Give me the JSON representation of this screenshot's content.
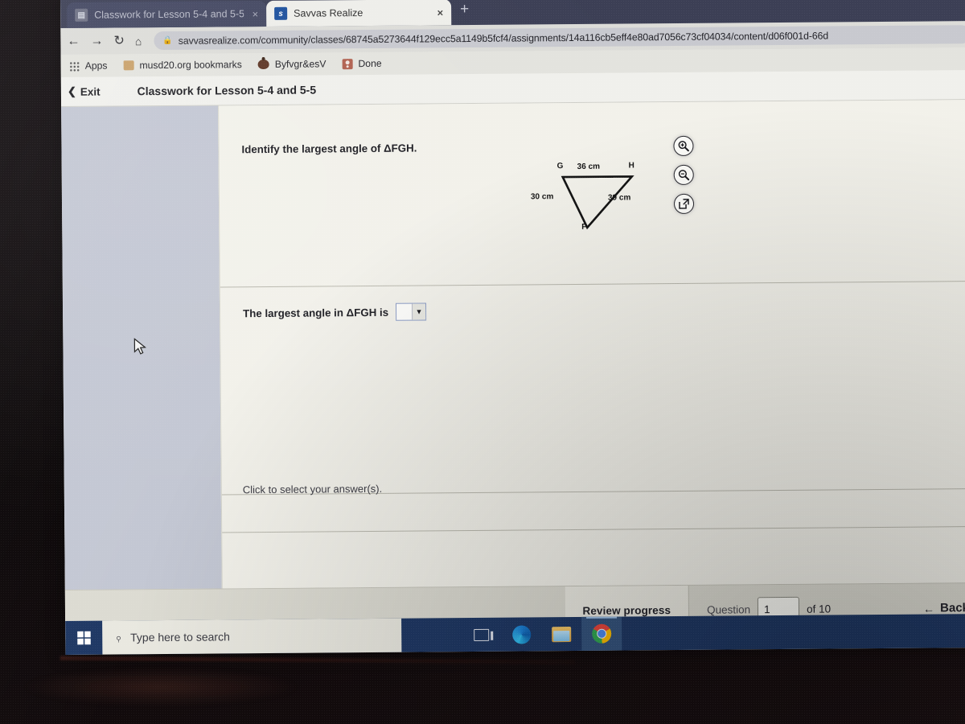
{
  "browser": {
    "tabs": [
      {
        "title": "Classwork for Lesson 5-4 and 5-5",
        "favicon": "page-icon",
        "close": "×",
        "active": false
      },
      {
        "title": "Savvas Realize",
        "favicon": "savvas-favicon",
        "close": "×",
        "active": true
      }
    ],
    "new_tab_label": "+",
    "nav": {
      "back": "←",
      "forward": "→",
      "reload": "↻",
      "home": "⌂",
      "lock_icon": "lock-icon",
      "url": "savvasrealize.com/community/classes/68745a5273644f129ecc5a1149b5fcf4/assignments/14a116cb5eff4e80ad7056c73cf04034/content/d06f001d-66d"
    },
    "bookmarks": [
      {
        "label": "Apps",
        "icon": "apps-grid-icon"
      },
      {
        "label": "musd20.org bookmarks",
        "icon": "folder-icon"
      },
      {
        "label": "Byfvgr&esV",
        "icon": "pumpkin-icon"
      },
      {
        "label": "Done",
        "icon": "contact-icon"
      }
    ]
  },
  "app": {
    "exit_label": "Exit",
    "lesson_title": "Classwork for Lesson 5-4 and 5-5"
  },
  "question": {
    "stem": "Identify the largest angle of ΔFGH.",
    "answer_prompt": "The largest angle in ΔFGH is",
    "dropdown_value": "",
    "dropdown_arrow": "▼",
    "hint": "Click to select your answer(s).",
    "figure_tools": [
      {
        "name": "zoom-in-icon",
        "label": "zoom in"
      },
      {
        "name": "zoom-out-icon",
        "label": "zoom out"
      },
      {
        "name": "open-external-icon",
        "label": "open in new window"
      }
    ]
  },
  "figure": {
    "type": "triangle-diagram",
    "vertices": [
      {
        "label": "G",
        "position": "top-left"
      },
      {
        "label": "H",
        "position": "top-right"
      },
      {
        "label": "F",
        "position": "bottom"
      }
    ],
    "sides": [
      {
        "label": "36 cm",
        "between": "GH",
        "length": 36,
        "unit": "cm"
      },
      {
        "label": "30 cm",
        "between": "GF",
        "length": 30,
        "unit": "cm"
      },
      {
        "label": "39 cm",
        "between": "FH",
        "length": 39,
        "unit": "cm"
      }
    ]
  },
  "bottom_bar": {
    "review_label": "Review progress",
    "question_label": "Question",
    "question_number": "1",
    "of_label": "of 10",
    "total": 10,
    "smudge": "",
    "back_label": "Back",
    "back_arrow": "←"
  },
  "taskbar": {
    "start_icon": "windows-logo-icon",
    "search_placeholder": "Type here to search",
    "search_value": "",
    "search_icon": "search-icon",
    "items": [
      {
        "name": "task-view-icon",
        "label": "Task View",
        "active": false
      },
      {
        "name": "edge-icon",
        "label": "Microsoft Edge",
        "active": false
      },
      {
        "name": "file-explorer-icon",
        "label": "File Explorer",
        "active": false
      },
      {
        "name": "chrome-icon",
        "label": "Google Chrome",
        "active": true
      }
    ]
  },
  "colors": {
    "tab_strip": "#3c3f55",
    "taskbar": "#1f3864",
    "sidebar": "#c3c7d3",
    "content": "#f2f1ea",
    "dropdown_border": "#8a9bc4"
  }
}
